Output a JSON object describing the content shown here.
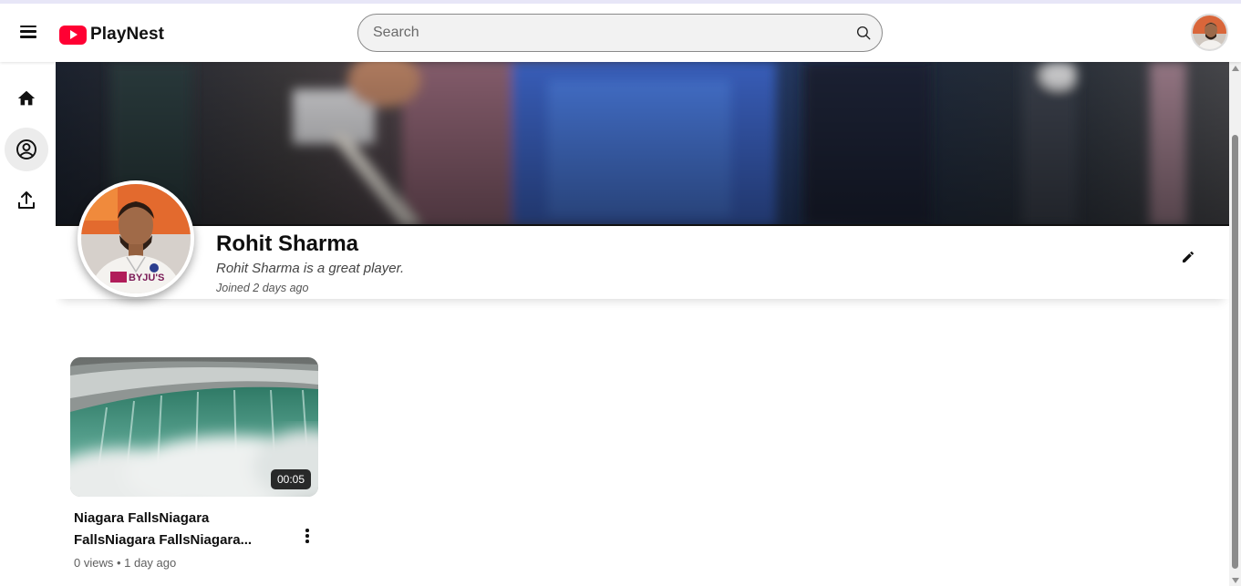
{
  "header": {
    "app_name": "PlayNest",
    "search_placeholder": "Search"
  },
  "icons": {
    "menu": "hamburger-menu-icon",
    "logo": "play-logo-icon",
    "search": "search-icon",
    "home": "home-icon",
    "profile": "user-circle-icon",
    "upload": "upload-icon",
    "edit": "pencil-icon",
    "more": "more-vert-icon"
  },
  "sidebar": {
    "items": [
      {
        "label": "Home",
        "icon": "home-icon"
      },
      {
        "label": "Profile",
        "icon": "user-circle-icon",
        "active": true
      },
      {
        "label": "Upload",
        "icon": "upload-icon"
      }
    ]
  },
  "channel": {
    "name": "Rohit Sharma",
    "description": "Rohit Sharma is a great player.",
    "joined": "Joined 2 days ago",
    "avatar_jersey_text": "BYJU'S"
  },
  "videos": [
    {
      "title": "Niagara FallsNiagara FallsNiagara FallsNiagara...",
      "duration": "00:05",
      "meta": "0 views • 1 day ago"
    }
  ],
  "colors": {
    "brand_red": "#ff0033",
    "active_sidebar_bg": "#ececec",
    "text_primary": "#0f0f0f",
    "text_secondary": "#606060"
  }
}
